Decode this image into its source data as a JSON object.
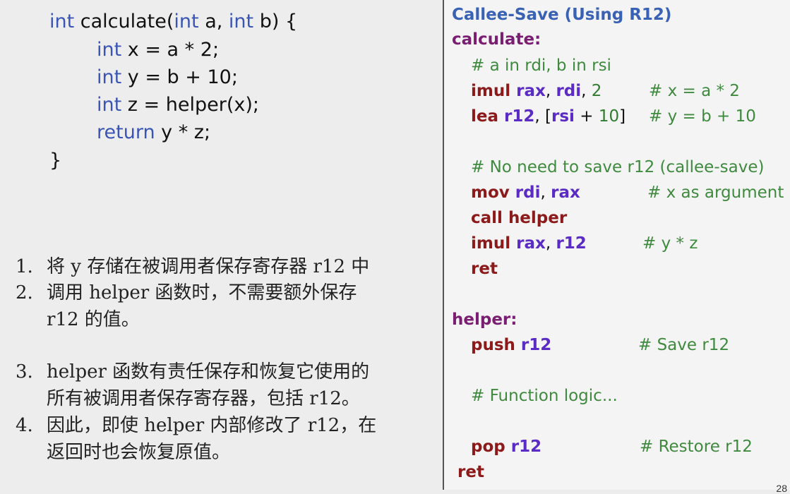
{
  "c_code": {
    "l1": {
      "kw1": "int",
      "t1": " calculate(",
      "kw2": "int",
      "t2": " a, ",
      "kw3": "int",
      "t3": " b) {"
    },
    "l2": {
      "kw": "int",
      "t": " x = a * 2;"
    },
    "l3": {
      "kw": "int",
      "t": " y = b + 10;"
    },
    "l4": {
      "kw": "int",
      "t": " z = helper(x);"
    },
    "l5": {
      "kw": "return",
      "t": " y * z;"
    },
    "l6": {
      "t": "}"
    }
  },
  "notes": [
    {
      "num": "1.",
      "lines": [
        "将 y 存储在被调用者保存寄存器 r12 中"
      ]
    },
    {
      "num": "2.",
      "lines": [
        "调用 helper 函数时，不需要额外保存",
        "r12 的值。"
      ]
    },
    {
      "num": "3.",
      "lines": [
        "helper 函数有责任保存和恢复它使用的",
        "所有被调用者保存寄存器，包括 r12。"
      ]
    },
    {
      "num": "4.",
      "lines": [
        "因此，即使 helper 内部修改了 r12，在",
        "返回时也会恢复原值。"
      ]
    }
  ],
  "asm": {
    "title": "Callee-Save (Using R12)",
    "calc_label": "calculate:",
    "c_args": "# a in rdi, b in rsi",
    "imul1": {
      "op": "imul",
      "r1": "rax",
      "sep1": ", ",
      "r2": "rdi",
      "sep2": ", ",
      "n": "2",
      "cmt": "# x = a * 2"
    },
    "lea": {
      "op": "lea",
      "r1": "r12",
      "sep1": ", [",
      "r2": "rsi",
      "sep2": " + ",
      "n": "10",
      "end": "]",
      "cmt": "# y = b + 10"
    },
    "c_noneed": "# No need to save r12 (callee-save)",
    "mov": {
      "op": "mov",
      "r1": "rdi",
      "sep": ", ",
      "r2": "rax",
      "cmt": "# x as argument"
    },
    "call": {
      "op": "call",
      "target": "helper"
    },
    "imul2": {
      "op": "imul",
      "r1": "rax",
      "sep": ", ",
      "r2": "r12",
      "cmt": "# y * z"
    },
    "ret1": "ret",
    "helper_label": "helper:",
    "push": {
      "op": "push",
      "r": "r12",
      "cmt": "# Save r12"
    },
    "c_logic": "# Function logic...",
    "pop": {
      "op": "pop",
      "r": "r12",
      "cmt": "# Restore r12"
    },
    "ret2": "ret"
  },
  "page_number": "28"
}
